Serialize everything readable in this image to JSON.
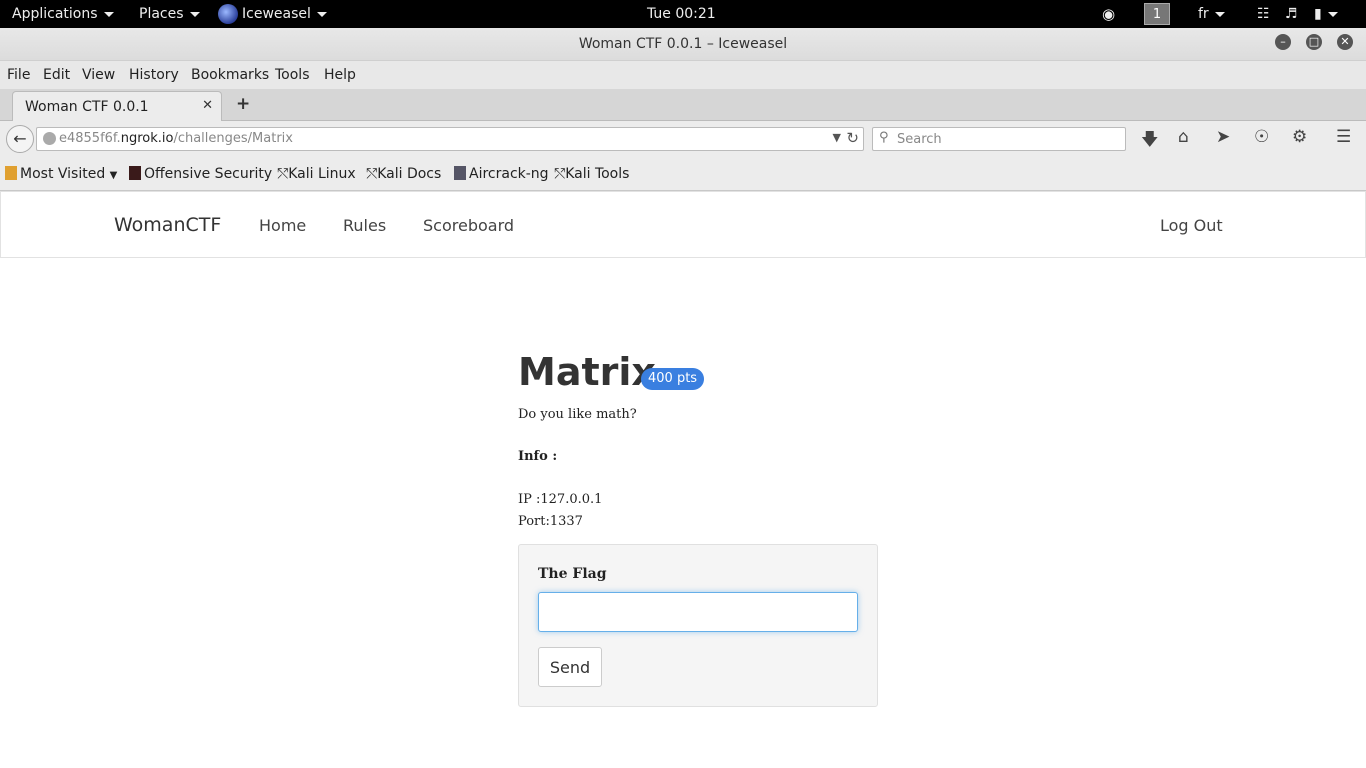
{
  "system_bar": {
    "applications": "Applications",
    "places": "Places",
    "app_name": "Iceweasel",
    "clock": "Tue 00:21",
    "workspace": "1",
    "keyboard_layout": "fr"
  },
  "window": {
    "title": "Woman CTF 0.0.1 – Iceweasel"
  },
  "menu": [
    "File",
    "Edit",
    "View",
    "History",
    "Bookmarks",
    "Tools",
    "Help"
  ],
  "tab": {
    "label": "Woman CTF 0.0.1"
  },
  "nav": {
    "url_domain_prefix": "e4855f6f.",
    "url_domain": "ngrok.io",
    "url_path": "/challenges/Matrix",
    "search_placeholder": "Search"
  },
  "bookmarks": [
    "Most Visited",
    "Offensive Security",
    "Kali Linux",
    "Kali Docs",
    "Aircrack-ng",
    "Kali Tools"
  ],
  "site": {
    "brand": "WomanCTF",
    "links": [
      "Home",
      "Rules",
      "Scoreboard"
    ],
    "logout": "Log Out"
  },
  "challenge": {
    "title": "Matrix",
    "points": "400 pts",
    "description": "Do you like math?",
    "info_heading": "Info :",
    "ip": "IP :127.0.0.1",
    "port": "Port:1337",
    "flag_label": "The Flag",
    "flag_value": "",
    "send_label": "Send"
  },
  "colors": {
    "badge": "#3a7fe0",
    "focus_border": "#66afe9",
    "topbar": "#000000"
  }
}
